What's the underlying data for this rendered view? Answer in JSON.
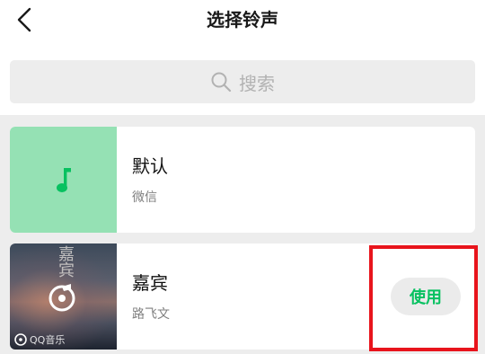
{
  "header": {
    "back_icon": "chevron-left-icon",
    "title": "选择铃声"
  },
  "search": {
    "icon": "search-icon",
    "placeholder": "搜索"
  },
  "ringtones": [
    {
      "name": "默认",
      "artist": "微信",
      "thumbnail": "music-note-icon",
      "thumbnail_color": "#95e1b4",
      "note_color": "#07c160"
    },
    {
      "name": "嘉宾",
      "artist": "路飞文",
      "thumbnail": "album-cover",
      "cover_title": "嘉宾",
      "cover_watermark": "QQ音乐",
      "action_label": "使用",
      "action_color": "#07c160"
    }
  ],
  "annotation": {
    "highlight_color": "#e8141c"
  }
}
